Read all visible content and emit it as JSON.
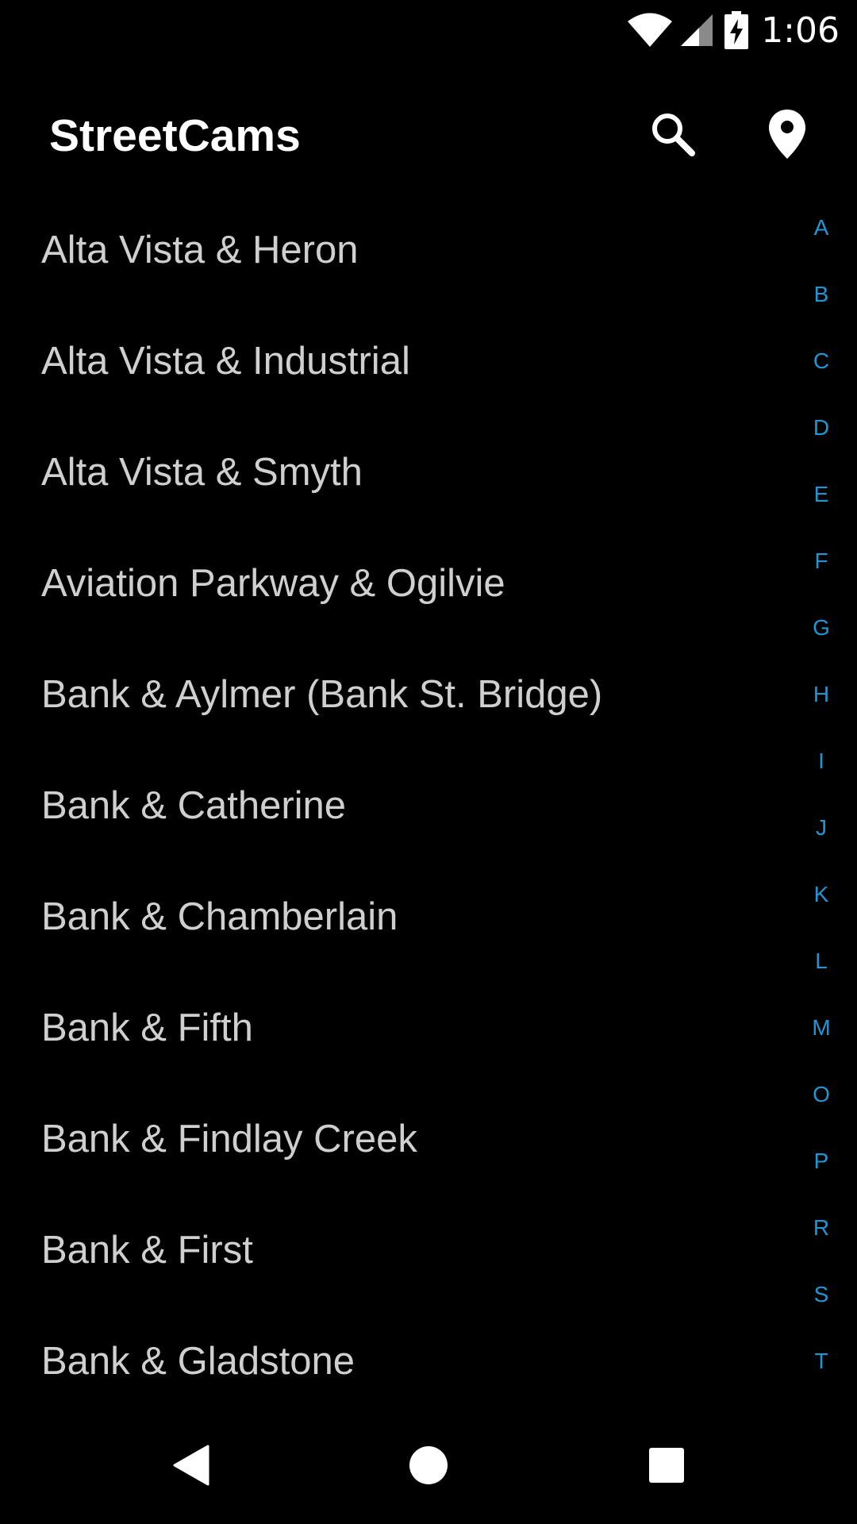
{
  "status_bar": {
    "time": "1:06",
    "icons": [
      "wifi-icon",
      "cell-signal-icon",
      "battery-charging-icon"
    ]
  },
  "app_bar": {
    "title": "StreetCams",
    "actions": [
      "search-icon",
      "location-pin-icon"
    ]
  },
  "cameras": [
    "Alta Vista & Heron",
    "Alta Vista & Industrial",
    "Alta Vista & Smyth",
    "Aviation Parkway & Ogilvie",
    "Bank & Aylmer (Bank St. Bridge)",
    "Bank & Catherine",
    "Bank & Chamberlain",
    "Bank & Fifth",
    "Bank & Findlay Creek",
    "Bank & First",
    "Bank & Gladstone"
  ],
  "alphabet_index": [
    "A",
    "B",
    "C",
    "D",
    "E",
    "F",
    "G",
    "H",
    "I",
    "J",
    "K",
    "L",
    "M",
    "O",
    "P",
    "R",
    "S",
    "T"
  ],
  "nav_bar": {
    "icons": [
      "back-icon",
      "home-icon",
      "recents-icon"
    ]
  },
  "colors": {
    "background": "#000000",
    "title": "#ffffff",
    "list_text": "#cfcfcf",
    "index_accent": "#2196d3"
  }
}
